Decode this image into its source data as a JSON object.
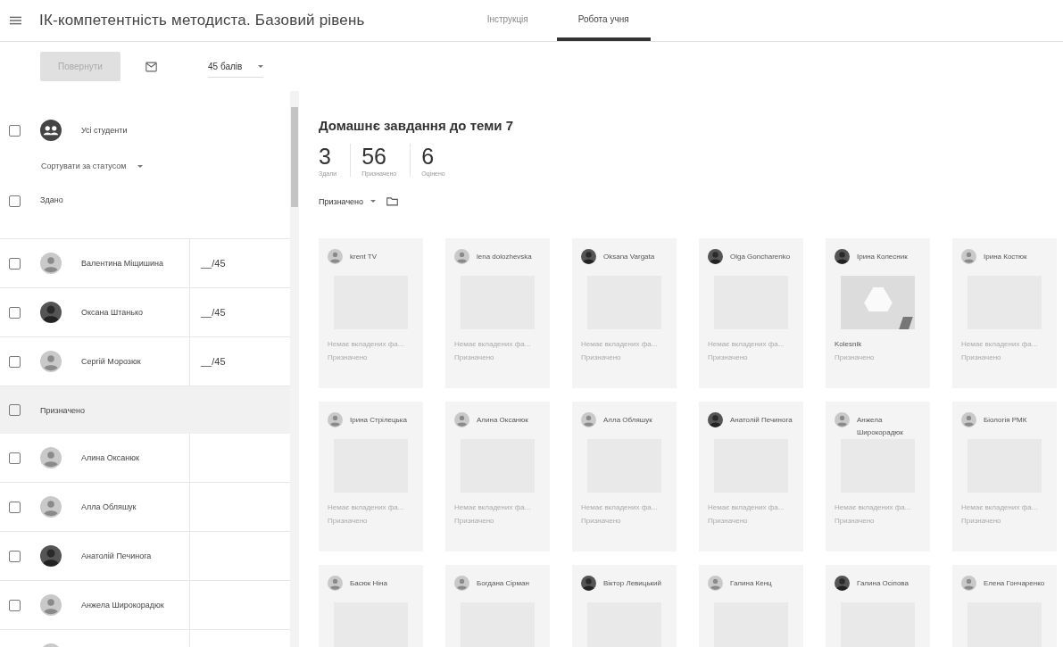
{
  "header": {
    "title": "ІК-компетентність методиста. Базовий рівень",
    "tabs": [
      {
        "label": "Інструкція",
        "selected": false
      },
      {
        "label": "Робота учня",
        "selected": true
      }
    ]
  },
  "toolbar": {
    "return_button": {
      "label": "Повернути",
      "disabled": true
    },
    "points_select": {
      "value": "45 балів"
    }
  },
  "roster": {
    "all_students": {
      "label": "Усі студенти",
      "checked": false
    },
    "sort": {
      "label": "Сортувати за статусом"
    },
    "groups": [
      {
        "label": "Здано",
        "checked": false,
        "highlighted": false,
        "students": [
          {
            "name": "Валентина Міщишина",
            "avatar": {
              "kind": "generic"
            },
            "grade": "__/45",
            "checked": false
          },
          {
            "name": "Оксана Штанько",
            "avatar": {
              "kind": "photo"
            },
            "grade": "__/45",
            "checked": false
          },
          {
            "name": "Сергій Морозюк",
            "avatar": {
              "kind": "generic"
            },
            "grade": "__/45",
            "checked": false
          }
        ]
      },
      {
        "label": "Призначено",
        "checked": false,
        "highlighted": true,
        "students": [
          {
            "name": "Алина Оксанюк",
            "avatar": {
              "kind": "generic"
            },
            "checked": false
          },
          {
            "name": "Алла Обляшук",
            "avatar": {
              "kind": "generic"
            },
            "checked": false
          },
          {
            "name": "Анатолій Печинога",
            "avatar": {
              "kind": "photo"
            },
            "checked": false
          },
          {
            "name": "Анжела Широкорадюк",
            "avatar": {
              "kind": "generic"
            },
            "checked": false
          },
          {
            "avatar": {
              "kind": "generic"
            }
          }
        ]
      }
    ]
  },
  "assignment": {
    "title": "Домашнє завдання до теми 7",
    "stats": [
      {
        "value": "3",
        "label": "Здали"
      },
      {
        "value": "56",
        "label": "Призначено"
      },
      {
        "value": "6",
        "label": "Оцінено"
      }
    ],
    "filter": {
      "label": "Призначено"
    },
    "cards": [
      {
        "name": "krent TV",
        "avatar": {
          "kind": "generic"
        },
        "thumbnail": {
          "kind": "empty"
        },
        "attachment": "Немає вкладених фа...",
        "status": "Призначено"
      },
      {
        "name": "lena dolozhevska",
        "avatar": {
          "kind": "generic"
        },
        "thumbnail": {
          "kind": "empty"
        },
        "attachment": "Немає вкладених фа...",
        "status": "Призначено"
      },
      {
        "name": "Oksana Vargata",
        "avatar": {
          "kind": "photo"
        },
        "thumbnail": {
          "kind": "empty"
        },
        "attachment": "Немає вкладених фа...",
        "status": "Призначено"
      },
      {
        "name": "Olga Goncharenko",
        "avatar": {
          "kind": "photo"
        },
        "thumbnail": {
          "kind": "empty"
        },
        "attachment": "Немає вкладених фа...",
        "status": "Призначено"
      },
      {
        "name": "Ірина Колесник",
        "avatar": {
          "kind": "photo"
        },
        "thumbnail": {
          "kind": "drive"
        },
        "attachment": "Kolesnik",
        "status": "Призначено"
      },
      {
        "name": "Ірина Костюк",
        "avatar": {
          "kind": "generic"
        },
        "thumbnail": {
          "kind": "empty"
        },
        "attachment": "Немає вкладених фа...",
        "status": "Призначено"
      },
      {
        "name": "Ірина Стрілецька",
        "avatar": {
          "kind": "generic"
        },
        "thumbnail": {
          "kind": "empty"
        },
        "attachment": "Немає вкладених фа...",
        "status": "Призначено"
      },
      {
        "name": "Алина Оксанюк",
        "avatar": {
          "kind": "generic"
        },
        "thumbnail": {
          "kind": "empty"
        },
        "attachment": "Немає вкладених фа...",
        "status": "Призначено"
      },
      {
        "name": "Алла Обляшук",
        "avatar": {
          "kind": "generic"
        },
        "thumbnail": {
          "kind": "empty"
        },
        "attachment": "Немає вкладених фа...",
        "status": "Призначено"
      },
      {
        "name": "Анатолій Печинога",
        "avatar": {
          "kind": "photo"
        },
        "thumbnail": {
          "kind": "empty"
        },
        "attachment": "Немає вкладених фа...",
        "status": "Призначено"
      },
      {
        "name": "Анжела Широкорадюк",
        "avatar": {
          "kind": "generic"
        },
        "thumbnail": {
          "kind": "empty"
        },
        "attachment": "Немає вкладених фа...",
        "status": "Призначено"
      },
      {
        "name": "Біологія РМК",
        "avatar": {
          "kind": "generic"
        },
        "thumbnail": {
          "kind": "empty"
        },
        "attachment": "Немає вкладених фа...",
        "status": "Призначено"
      },
      {
        "name": "Басюк Ніна",
        "avatar": {
          "kind": "generic"
        },
        "thumbnail": {
          "kind": "empty"
        }
      },
      {
        "name": "Богдана Сірман",
        "avatar": {
          "kind": "generic"
        },
        "thumbnail": {
          "kind": "empty"
        }
      },
      {
        "name": "Віктор Левицький",
        "avatar": {
          "kind": "photo"
        },
        "thumbnail": {
          "kind": "empty"
        }
      },
      {
        "name": "Галина Кенц",
        "avatar": {
          "kind": "generic"
        },
        "thumbnail": {
          "kind": "empty"
        }
      },
      {
        "name": "Галина Осіпова",
        "avatar": {
          "kind": "photo"
        },
        "thumbnail": {
          "kind": "empty"
        }
      },
      {
        "name": "Елена Гончаренко",
        "avatar": {
          "kind": "generic"
        },
        "thumbnail": {
          "kind": "empty"
        }
      }
    ]
  }
}
